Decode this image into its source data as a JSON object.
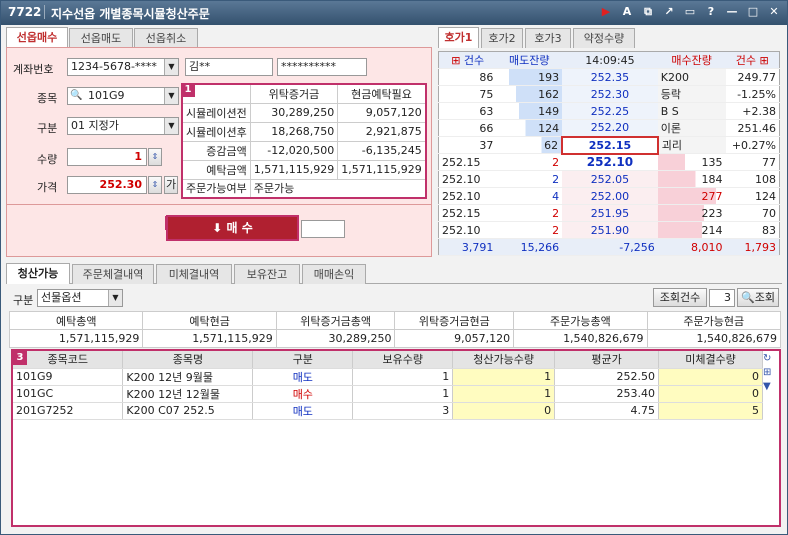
{
  "window": {
    "code": "7722",
    "title": "지수선옵 개별종목시뮬청산주문",
    "icons": [
      "flag-red",
      "font-icon",
      "popup-icon",
      "link-icon",
      "window-icon",
      "help-icon",
      "minimize-icon",
      "maximize-icon",
      "close-icon"
    ]
  },
  "left_tabs": [
    "선옵매수",
    "선옵매도",
    "선옵취소"
  ],
  "form": {
    "account_label": "계좌번호",
    "account_value": "1234-5678-****",
    "owner": "김**",
    "password": "**********",
    "code_label": "종목",
    "code_value": "101G9",
    "type_label": "구분",
    "type_value": "01 지정가",
    "qty_label": "수량",
    "qty_value": "1",
    "price_label": "가격",
    "price_value": "252.30",
    "price_suffix": "가",
    "submit_label": "매 수",
    "badge1": "1",
    "badge2": "2"
  },
  "sim": {
    "headers": [
      "",
      "위탁증거금",
      "현금예탁필요"
    ],
    "rows": [
      [
        "시뮬레이션전",
        "30,289,250",
        "9,057,120"
      ],
      [
        "시뮬레이션후",
        "18,268,750",
        "2,921,875"
      ],
      [
        "증감금액",
        "-12,020,500",
        "-6,135,245"
      ],
      [
        "예탁금액",
        "1,571,115,929",
        "1,571,115,929"
      ]
    ],
    "avail_label": "주문가능여부",
    "avail_value": "주문가능"
  },
  "right_tabs": [
    "호가1",
    "호가2",
    "호가3",
    "약정수량"
  ],
  "orderbook": {
    "headers": [
      "건수",
      "매도잔량",
      "14:09:45",
      "매수잔량",
      "건수"
    ],
    "asks": [
      [
        "86",
        "193",
        "252.35",
        "K200",
        "249.77"
      ],
      [
        "75",
        "162",
        "252.30",
        "등락",
        "-1.25%"
      ],
      [
        "63",
        "149",
        "252.25",
        "B S",
        "+2.38"
      ],
      [
        "66",
        "124",
        "252.20",
        "이론",
        "251.46"
      ],
      [
        "37",
        "62",
        "252.15",
        "괴리",
        "+0.27%"
      ]
    ],
    "bids": [
      [
        "252.15",
        "2",
        "252.10",
        "135",
        "77"
      ],
      [
        "252.10",
        "2",
        "252.05",
        "184",
        "108"
      ],
      [
        "252.10",
        "4",
        "252.00",
        "277",
        "124"
      ],
      [
        "252.15",
        "2",
        "251.95",
        "223",
        "70"
      ],
      [
        "252.10",
        "2",
        "251.90",
        "214",
        "83"
      ]
    ],
    "footer": [
      "3,791",
      "15,266",
      "-7,256",
      "8,010",
      "1,793"
    ]
  },
  "bottom_tabs": [
    "청산가능",
    "주문체결내역",
    "미체결내역",
    "보유잔고",
    "매매손익"
  ],
  "filter": {
    "label": "구분",
    "value": "선물옵션",
    "count_label": "조회건수",
    "count_value": "3",
    "search_label": "조회"
  },
  "summary": {
    "headers": [
      "예탁총액",
      "예탁현금",
      "위탁증거금총액",
      "위탁증거금현금",
      "주문가능총액",
      "주문가능현금"
    ],
    "values": [
      "1,571,115,929",
      "1,571,115,929",
      "30,289,250",
      "9,057,120",
      "1,540,826,679",
      "1,540,826,679"
    ]
  },
  "positions": {
    "badge": "3",
    "headers": [
      "종목코드",
      "종목명",
      "구분",
      "보유수량",
      "청산가능수량",
      "평균가",
      "미체결수량"
    ],
    "rows": [
      [
        "101G9",
        "K200 12년 9월물",
        "매도",
        "1",
        "1",
        "252.50",
        "0"
      ],
      [
        "101GC",
        "K200 12년 12월물",
        "매수",
        "1",
        "1",
        "253.40",
        "0"
      ],
      [
        "201G7252",
        "K200 C07 252.5",
        "매도",
        "3",
        "0",
        "4.75",
        "5"
      ]
    ]
  }
}
